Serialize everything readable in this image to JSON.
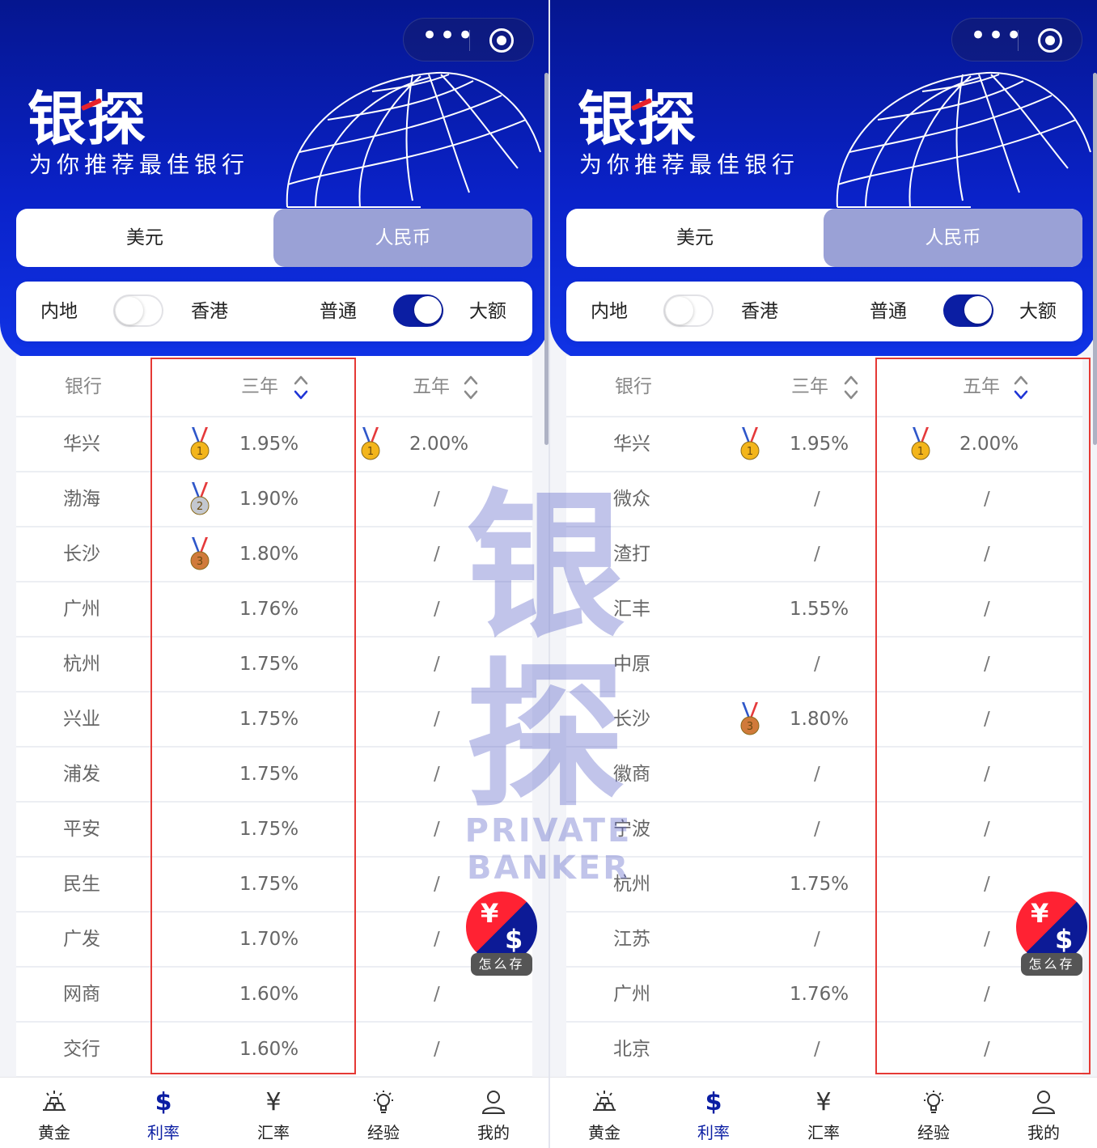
{
  "app": {
    "logo": "银探",
    "slogan": "为你推荐最佳银行",
    "capsule_more": "•••"
  },
  "currency_tabs": {
    "usd": "美元",
    "cny": "人民币",
    "selected": "人民币"
  },
  "filters": {
    "region_left": "内地",
    "region_right": "香港",
    "region_toggle_on": false,
    "amount_left": "普通",
    "amount_right": "大额",
    "amount_toggle_on": true
  },
  "table_headers": {
    "bank": "银行",
    "three_year": "三年",
    "five_year": "五年"
  },
  "left_panel": {
    "sorted_by": "三年",
    "rows": [
      {
        "bank": "华兴",
        "three_year": "1.95%",
        "five_year": "2.00%",
        "medal3": "gold",
        "medal5": "gold"
      },
      {
        "bank": "渤海",
        "three_year": "1.90%",
        "five_year": "/",
        "medal3": "silver"
      },
      {
        "bank": "长沙",
        "three_year": "1.80%",
        "five_year": "/",
        "medal3": "bronze"
      },
      {
        "bank": "广州",
        "three_year": "1.76%",
        "five_year": "/"
      },
      {
        "bank": "杭州",
        "three_year": "1.75%",
        "five_year": "/"
      },
      {
        "bank": "兴业",
        "three_year": "1.75%",
        "five_year": "/"
      },
      {
        "bank": "浦发",
        "three_year": "1.75%",
        "five_year": "/"
      },
      {
        "bank": "平安",
        "three_year": "1.75%",
        "five_year": "/"
      },
      {
        "bank": "民生",
        "three_year": "1.75%",
        "five_year": "/"
      },
      {
        "bank": "广发",
        "three_year": "1.70%",
        "five_year": "/"
      },
      {
        "bank": "网商",
        "three_year": "1.60%",
        "five_year": "/"
      },
      {
        "bank": "交行",
        "three_year": "1.60%",
        "five_year": "/"
      }
    ]
  },
  "right_panel": {
    "sorted_by": "五年",
    "rows": [
      {
        "bank": "华兴",
        "three_year": "1.95%",
        "five_year": "2.00%",
        "medal3": "gold",
        "medal5": "gold"
      },
      {
        "bank": "微众",
        "three_year": "/",
        "five_year": "/"
      },
      {
        "bank": "渣打",
        "three_year": "/",
        "five_year": "/"
      },
      {
        "bank": "汇丰",
        "three_year": "1.55%",
        "five_year": "/"
      },
      {
        "bank": "中原",
        "three_year": "/",
        "five_year": "/"
      },
      {
        "bank": "长沙",
        "three_year": "1.80%",
        "five_year": "/",
        "medal3": "bronze"
      },
      {
        "bank": "徽商",
        "three_year": "/",
        "five_year": "/"
      },
      {
        "bank": "宁波",
        "three_year": "/",
        "five_year": "/"
      },
      {
        "bank": "杭州",
        "three_year": "1.75%",
        "five_year": "/"
      },
      {
        "bank": "江苏",
        "three_year": "/",
        "five_year": "/"
      },
      {
        "bank": "广州",
        "three_year": "1.76%",
        "five_year": "/"
      },
      {
        "bank": "北京",
        "three_year": "/",
        "five_year": "/"
      }
    ]
  },
  "fab": {
    "yen": "¥",
    "dollar": "$",
    "label": "怎么存"
  },
  "watermark": {
    "big": "银探",
    "small": "PRIVATE BANKER"
  },
  "tabbar": [
    {
      "label": "黄金",
      "icon": "gold-bars-icon"
    },
    {
      "label": "利率",
      "icon": "dollar-icon",
      "symbol": "$",
      "active": true
    },
    {
      "label": "汇率",
      "icon": "yen-icon",
      "symbol": "¥"
    },
    {
      "label": "经验",
      "icon": "lightbulb-icon"
    },
    {
      "label": "我的",
      "icon": "user-icon"
    }
  ],
  "colors": {
    "brand_blue": "#0b1ea3",
    "highlight_red": "#e53935",
    "tab_selected": "#9aa1d6"
  }
}
